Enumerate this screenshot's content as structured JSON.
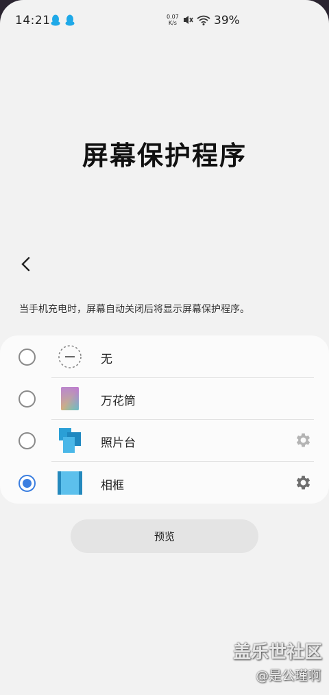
{
  "status_bar": {
    "time": "14:21",
    "net_speed_value": "0.07",
    "net_speed_unit": "K/s",
    "battery": "39%"
  },
  "page": {
    "title": "屏幕保护程序",
    "description": "当手机充电时，屏幕自动关闭后将显示屏幕保护程序。"
  },
  "options": [
    {
      "label": "无",
      "selected": false,
      "has_settings": false,
      "icon": "none-icon"
    },
    {
      "label": "万花筒",
      "selected": false,
      "has_settings": false,
      "icon": "kaleidoscope-icon"
    },
    {
      "label": "照片台",
      "selected": false,
      "has_settings": true,
      "icon": "photo-table-icon"
    },
    {
      "label": "相框",
      "selected": true,
      "has_settings": true,
      "icon": "photo-frame-icon"
    }
  ],
  "preview_label": "预览",
  "watermark": {
    "brand": "盖乐世社区",
    "credit": "@是公瑾啊"
  },
  "colors": {
    "accent": "#3c7fe0",
    "background": "#f2f2f2",
    "card": "#fbfbfb"
  }
}
